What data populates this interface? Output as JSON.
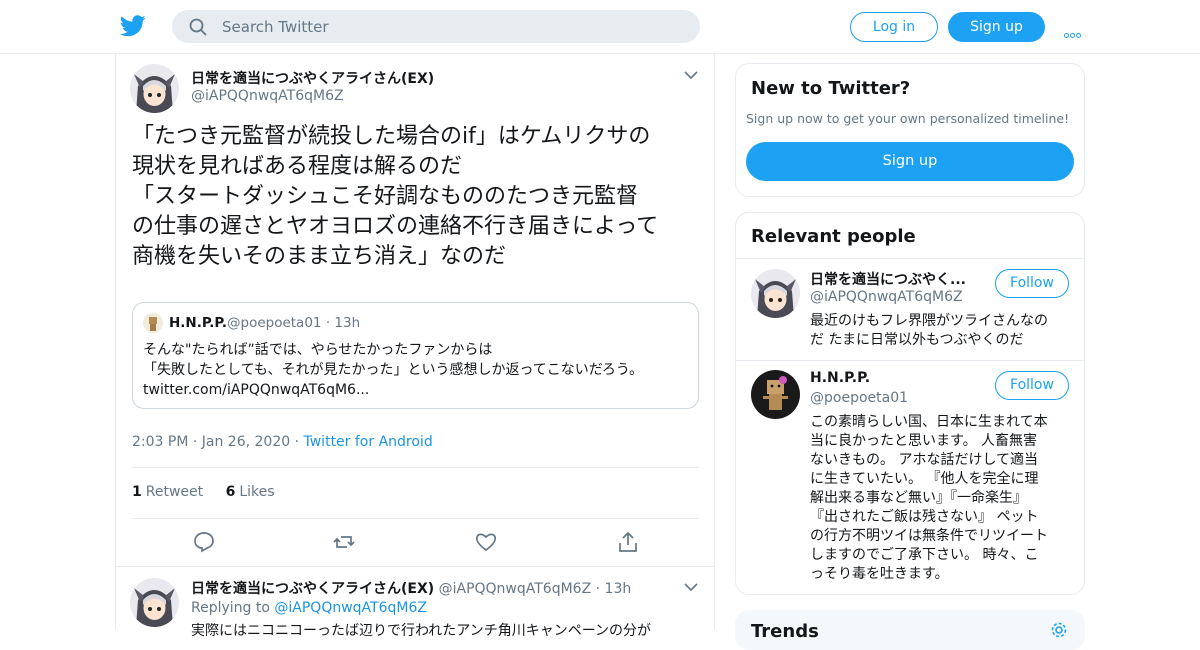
{
  "header": {
    "search_placeholder": "Search Twitter",
    "login_label": "Log in",
    "signup_label": "Sign up",
    "brand_color": "#1da1f2",
    "logo_icon": "twitter-bird-icon",
    "more_icon": "more-dots-icon"
  },
  "tweet": {
    "author_name": "日常を適当につぶやくアライさん(EX)",
    "author_handle": "@iAPQQnwqAT6qM6Z",
    "text": "「たつき元監督が続投した場合のif」はケムリクサの\n現状を見ればある程度は解るのだ\n「スタートダッシュこそ好調なもののたつき元監督\nの仕事の遅さとヤオヨロズの連絡不行き届きによって\n商機を失いそのまま立ち消え」なのだ",
    "quote": {
      "name": "H.N.P.P.",
      "handle": "@poepoeta01",
      "time": "· 13h",
      "text": "そんな\"たらればˮ話では、やらせたかったファンからは\n「失敗したとしても、それが見たかった」という感想しか返ってこないだろう。\ntwitter.com/iAPQQnwqAT6qM6..."
    },
    "time": "2:03 PM · Jan 26, 2020 · ",
    "source": "Twitter for Android",
    "retweet_count": "1",
    "retweet_label": "Retweet",
    "like_count": "6",
    "like_label": "Likes"
  },
  "reply": {
    "author_name": "日常を適当につぶやくアライさん(EX)",
    "author_handle": "@iAPQQnwqAT6qM6Z",
    "time": "· 13h",
    "replying_label": "Replying to",
    "replying_to": "@iAPQQnwqAT6qM6Z",
    "text": "実際にはニコニコーったば辺りで行われたアンチ角川キャンペーンの分が"
  },
  "sidebar": {
    "new_title": "New to Twitter?",
    "new_subtitle": "Sign up now to get your own personalized timeline!",
    "new_signup_label": "Sign up",
    "relevant_title": "Relevant people",
    "people": [
      {
        "name": "日常を適当につぶやく...",
        "handle": "@iAPQQnwqAT6qM6Z",
        "bio": "最近のけもフレ界隈がツライさんなの\nだ たまに日常以外もつぶやくのだ",
        "follow_label": "Follow"
      },
      {
        "name": "H.N.P.P.",
        "handle": "@poepoeta01",
        "bio": "この素晴らしい国、日本に生まれて本\n当に良かったと思います。 人畜無害\nないきもの。 アホな話だけして適当\nに生きていたい。 『他人を完全に理\n解出来る事など無い』『一命楽生』\n『出されたご飯は残さない』 ペット\nの行方不明ツイは無条件でリツイート\nしますのでご了承下さい。 時々、こ\nっそり毒を吐きます。",
        "follow_label": "Follow"
      }
    ],
    "trends_title": "Trends"
  }
}
